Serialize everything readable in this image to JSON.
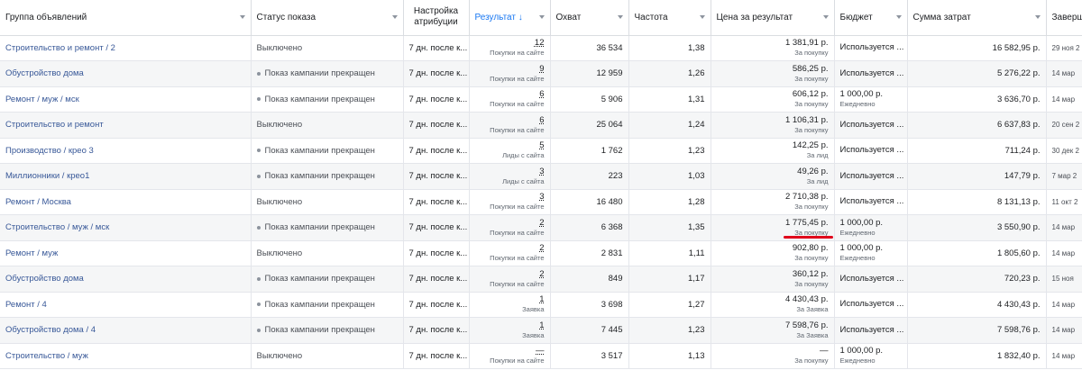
{
  "columns": [
    {
      "label": "Группа объявлений"
    },
    {
      "label": "Статус показа"
    },
    {
      "label": "Настройка атрибуции"
    },
    {
      "label": "Результат ↓"
    },
    {
      "label": "Охват"
    },
    {
      "label": "Частота"
    },
    {
      "label": "Цена за результат"
    },
    {
      "label": "Бюджет"
    },
    {
      "label": "Сумма затрат"
    },
    {
      "label": "Заверш"
    }
  ],
  "rows": [
    {
      "name": "Строительство и ремонт / 2",
      "status": "Выключено",
      "status_dot": false,
      "attr": "7 дн. после к...",
      "result": "12",
      "result_sub": "Покупки на сайте",
      "reach": "36 534",
      "freq": "1,38",
      "cpr": "1 381,91 р.",
      "cpr_sub": "За покупку",
      "budget": "Используется ...",
      "budget_sub": "",
      "spend": "16 582,95 р.",
      "end": "29 ноя 2"
    },
    {
      "name": "Обустройство дома",
      "status": "Показ кампании прекращен",
      "status_dot": true,
      "attr": "7 дн. после к...",
      "result": "9",
      "result_sub": "Покупки на сайте",
      "reach": "12 959",
      "freq": "1,26",
      "cpr": "586,25 р.",
      "cpr_sub": "За покупку",
      "budget": "Используется ...",
      "budget_sub": "",
      "spend": "5 276,22 р.",
      "end": "14 мар"
    },
    {
      "name": "Ремонт / муж / мск",
      "status": "Показ кампании прекращен",
      "status_dot": true,
      "attr": "7 дн. после к...",
      "result": "6",
      "result_sub": "Покупки на сайте",
      "reach": "5 906",
      "freq": "1,31",
      "cpr": "606,12 р.",
      "cpr_sub": "За покупку",
      "budget": "1 000,00 р.",
      "budget_sub": "Ежедневно",
      "spend": "3 636,70 р.",
      "end": "14 мар"
    },
    {
      "name": "Строительство и ремонт",
      "status": "Выключено",
      "status_dot": false,
      "attr": "7 дн. после к...",
      "result": "6",
      "result_sub": "Покупки на сайте",
      "reach": "25 064",
      "freq": "1,24",
      "cpr": "1 106,31 р.",
      "cpr_sub": "За покупку",
      "budget": "Используется ...",
      "budget_sub": "",
      "spend": "6 637,83 р.",
      "end": "20 сен 2"
    },
    {
      "name": "Производство / крео 3",
      "status": "Показ кампании прекращен",
      "status_dot": true,
      "attr": "7 дн. после к...",
      "result": "5",
      "result_sub": "Лиды с сайта",
      "reach": "1 762",
      "freq": "1,23",
      "cpr": "142,25 р.",
      "cpr_sub": "За лид",
      "budget": "Используется ...",
      "budget_sub": "",
      "spend": "711,24 р.",
      "end": "30 дек 2"
    },
    {
      "name": "Миллионники / крео1",
      "status": "Показ кампании прекращен",
      "status_dot": true,
      "attr": "7 дн. после к...",
      "result": "3",
      "result_sub": "Лиды с сайта",
      "reach": "223",
      "freq": "1,03",
      "cpr": "49,26 р.",
      "cpr_sub": "За лид",
      "budget": "Используется ...",
      "budget_sub": "",
      "spend": "147,79 р.",
      "end": "7 мар 2"
    },
    {
      "name": "Ремонт / Москва",
      "status": "Выключено",
      "status_dot": false,
      "attr": "7 дн. после к...",
      "result": "3",
      "result_sub": "Покупки на сайте",
      "reach": "16 480",
      "freq": "1,28",
      "cpr": "2 710,38 р.",
      "cpr_sub": "За покупку",
      "budget": "Используется ...",
      "budget_sub": "",
      "spend": "8 131,13 р.",
      "end": "11 окт 2"
    },
    {
      "name": "Строительство / муж / мск",
      "status": "Показ кампании прекращен",
      "status_dot": true,
      "attr": "7 дн. после к...",
      "result": "2",
      "result_sub": "Покупки на сайте",
      "reach": "6 368",
      "freq": "1,35",
      "cpr": "1 775,45 р.",
      "cpr_sub": "За покупку",
      "budget": "1 000,00 р.",
      "budget_sub": "Ежедневно",
      "spend": "3 550,90 р.",
      "end": "14 мар",
      "highlight": true
    },
    {
      "name": "Ремонт / муж",
      "status": "Выключено",
      "status_dot": false,
      "attr": "7 дн. после к...",
      "result": "2",
      "result_sub": "Покупки на сайте",
      "reach": "2 831",
      "freq": "1,11",
      "cpr": "902,80 р.",
      "cpr_sub": "За покупку",
      "budget": "1 000,00 р.",
      "budget_sub": "Ежедневно",
      "spend": "1 805,60 р.",
      "end": "14 мар"
    },
    {
      "name": "Обустройство дома",
      "status": "Показ кампании прекращен",
      "status_dot": true,
      "attr": "7 дн. после к...",
      "result": "2",
      "result_sub": "Покупки на сайте",
      "reach": "849",
      "freq": "1,17",
      "cpr": "360,12 р.",
      "cpr_sub": "За покупку",
      "budget": "Используется ...",
      "budget_sub": "",
      "spend": "720,23 р.",
      "end": "15 ноя"
    },
    {
      "name": "Ремонт / 4",
      "status": "Показ кампании прекращен",
      "status_dot": true,
      "attr": "7 дн. после к...",
      "result": "1",
      "result_sub": "Заявка",
      "reach": "3 698",
      "freq": "1,27",
      "cpr": "4 430,43 р.",
      "cpr_sub": "За Заявка",
      "budget": "Используется ...",
      "budget_sub": "",
      "spend": "4 430,43 р.",
      "end": "14 мар"
    },
    {
      "name": "Обустройство дома / 4",
      "status": "Показ кампании прекращен",
      "status_dot": true,
      "attr": "7 дн. после к...",
      "result": "1",
      "result_sub": "Заявка",
      "reach": "7 445",
      "freq": "1,23",
      "cpr": "7 598,76 р.",
      "cpr_sub": "За Заявка",
      "budget": "Используется ...",
      "budget_sub": "",
      "spend": "7 598,76 р.",
      "end": "14 мар"
    },
    {
      "name": "Строительство / муж",
      "status": "Выключено",
      "status_dot": false,
      "attr": "7 дн. после к...",
      "result": "—",
      "result_sub": "Покупки на сайте",
      "reach": "3 517",
      "freq": "1,13",
      "cpr": "—",
      "cpr_sub": "За покупку",
      "budget": "1 000,00 р.",
      "budget_sub": "Ежедневно",
      "spend": "1 832,40 р.",
      "end": "14 мар"
    }
  ]
}
